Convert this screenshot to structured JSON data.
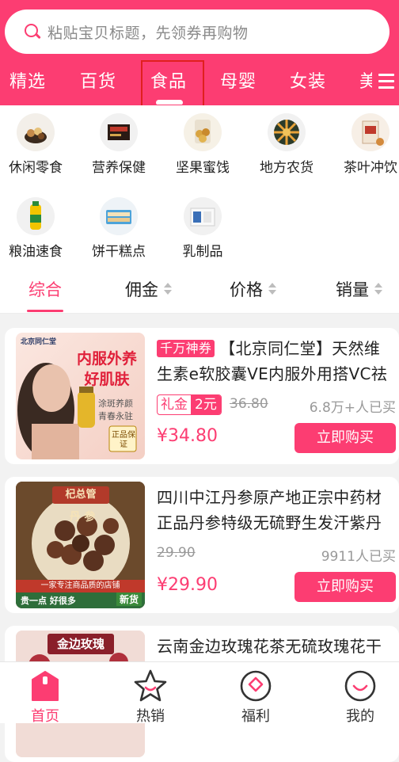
{
  "search": {
    "placeholder": "粘贴宝贝标题，先领券再购物"
  },
  "tabs": [
    "精选",
    "百货",
    "食品",
    "母婴",
    "女装",
    "美"
  ],
  "active_tab": "食品",
  "categories": [
    {
      "label": "休闲零食",
      "icon": "snacks-icon"
    },
    {
      "label": "营养保健",
      "icon": "health-supplement-icon"
    },
    {
      "label": "坚果蜜饯",
      "icon": "nuts-icon"
    },
    {
      "label": "地方农货",
      "icon": "local-produce-icon"
    },
    {
      "label": "茶叶冲饮",
      "icon": "tea-icon"
    },
    {
      "label": "粮油速食",
      "icon": "grain-oil-icon"
    },
    {
      "label": "饼干糕点",
      "icon": "biscuit-icon"
    },
    {
      "label": "乳制品",
      "icon": "dairy-icon"
    }
  ],
  "sort": {
    "items": [
      "综合",
      "佣金",
      "价格",
      "销量"
    ],
    "active": "综合"
  },
  "products": [
    {
      "badge": "千万神券",
      "title": "【北京同仁堂】天然维生素e软胶囊VE内服外用搭VC祛斑",
      "gift_label": "礼金",
      "gift_value": "2元",
      "orig_price": "36.80",
      "sold": "6.8万+人已买",
      "price": "¥34.80",
      "buy": "立即购买",
      "thumb_brand": "北京同仁堂",
      "thumb_headline": "内服外养 好肌肤",
      "thumb_lines": [
        "涂斑养颜",
        "青春永驻"
      ],
      "thumb_stamp": "正品保证"
    },
    {
      "title": "四川中江丹参原产地正宗中药材正品丹参特级无硫野生发汗紫丹参",
      "orig_price": "29.90",
      "sold": "9911人已买",
      "price": "¥29.90",
      "buy": "立即购买",
      "thumb_top": "杞总管",
      "thumb_mid": "丹 参",
      "thumb_banner": "一家专注商品质的店铺",
      "thumb_bottom": "贵一点 好很多",
      "thumb_tag": "新货"
    },
    {
      "title": "云南金边玫瑰花茶无硫玫瑰花干",
      "thumb_top": "金边玫瑰"
    }
  ],
  "tabbar": [
    {
      "label": "首页",
      "icon": "home-icon"
    },
    {
      "label": "热销",
      "icon": "star-icon"
    },
    {
      "label": "福利",
      "icon": "welfare-icon"
    },
    {
      "label": "我的",
      "icon": "profile-icon"
    }
  ],
  "colors": {
    "brand": "#fc3d72",
    "active_frame": "#e0201e"
  }
}
